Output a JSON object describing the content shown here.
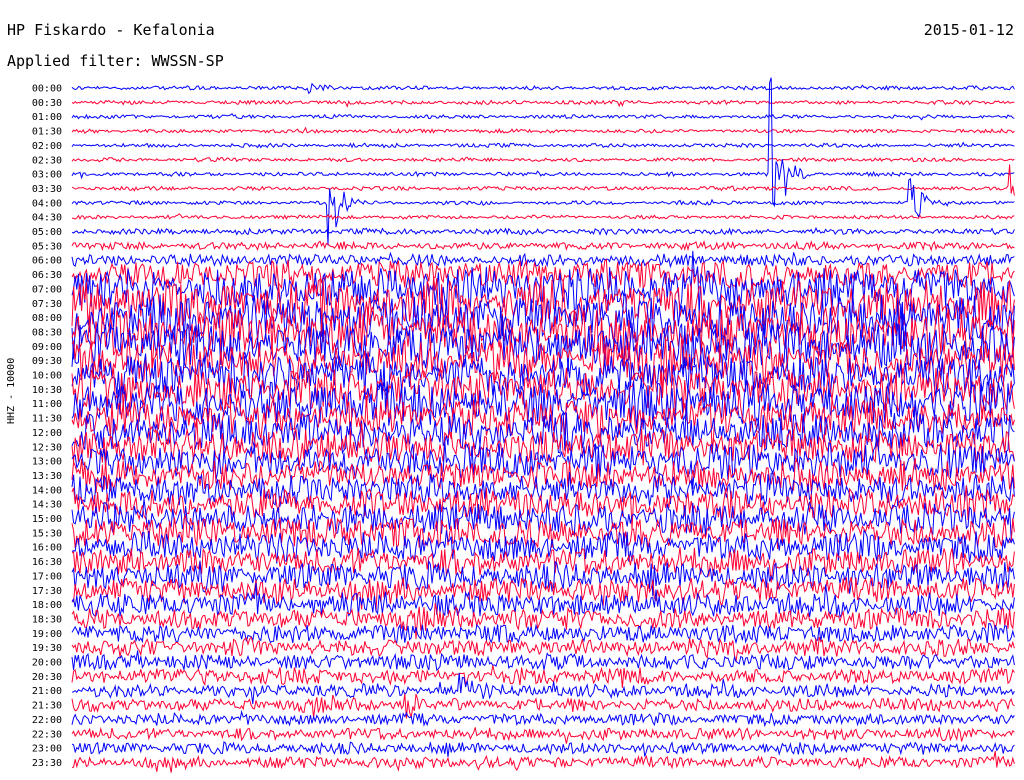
{
  "header": {
    "station": "HP Fiskardo - Kefalonia",
    "date": "2015-01-12",
    "filter": "Applied filter: WWSSN-SP"
  },
  "chart_data": {
    "type": "line",
    "title": "HP Fiskardo - Kefalonia",
    "subtitle": "Applied filter: WWSSN-SP",
    "ylabel": "HHZ - 10000",
    "tick_labels": [
      "00:00",
      "00:30",
      "01:00",
      "01:30",
      "02:00",
      "02:30",
      "03:00",
      "03:30",
      "04:00",
      "04:30",
      "05:00",
      "05:30",
      "06:00",
      "06:30",
      "07:00",
      "07:30",
      "08:00",
      "08:30",
      "09:00",
      "09:30",
      "10:00",
      "10:30",
      "11:00",
      "11:30",
      "12:00",
      "12:30",
      "13:00",
      "13:30",
      "14:00",
      "14:30",
      "15:00",
      "15:30",
      "16:00",
      "16:30",
      "17:00",
      "17:30",
      "18:00",
      "18:30",
      "19:00",
      "19:30",
      "20:00",
      "20:30",
      "21:00",
      "21:30",
      "22:00",
      "22:30",
      "23:00",
      "23:30"
    ],
    "series_colors": [
      "#0000ff",
      "#ff0033"
    ],
    "row_amplitude": [
      2,
      2,
      2,
      2,
      2,
      2,
      2,
      2,
      2,
      2,
      3,
      4,
      6,
      14,
      22,
      24,
      24,
      24,
      24,
      22,
      22,
      22,
      22,
      20,
      20,
      18,
      18,
      16,
      16,
      16,
      16,
      16,
      15,
      14,
      14,
      13,
      12,
      11,
      10,
      9,
      8,
      8,
      7,
      7,
      6,
      6,
      6,
      6
    ],
    "events": [
      {
        "row": 0,
        "x_frac": 0.252,
        "amplitude": 8
      },
      {
        "row": 6,
        "x_frac": 0.74,
        "amplitude": 120
      },
      {
        "row": 8,
        "x_frac": 0.273,
        "amplitude": 55
      },
      {
        "row": 7,
        "x_frac": 0.992,
        "amplitude": 55
      },
      {
        "row": 8,
        "x_frac": 0.888,
        "amplitude": 30
      },
      {
        "row": 42,
        "x_frac": 0.411,
        "amplitude": 30
      },
      {
        "row": 43,
        "x_frac": 0.353,
        "amplitude": 22
      }
    ]
  }
}
